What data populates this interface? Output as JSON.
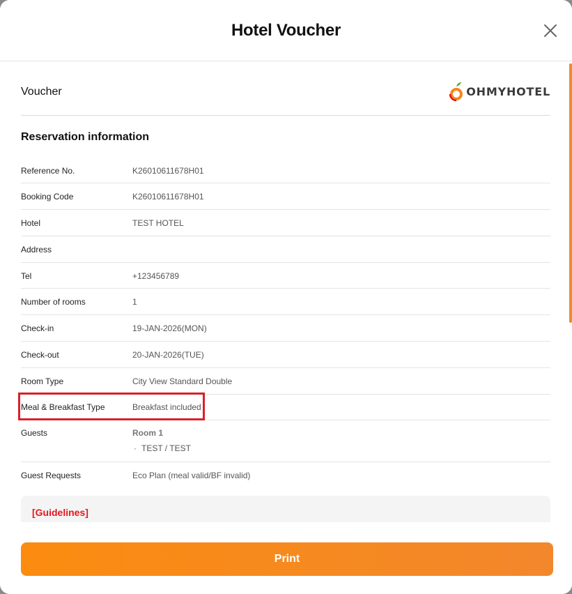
{
  "modal": {
    "title": "Hotel Voucher"
  },
  "voucher": {
    "label": "Voucher",
    "logo_text": "OHMYHOTEL"
  },
  "reservation": {
    "section_title": "Reservation information",
    "rows": [
      {
        "label": "Reference No.",
        "value": "K26010611678H01"
      },
      {
        "label": "Booking Code",
        "value": "K26010611678H01"
      },
      {
        "label": "Hotel",
        "value": "TEST HOTEL"
      },
      {
        "label": "Address",
        "value": ""
      },
      {
        "label": "Tel",
        "value": "+123456789"
      },
      {
        "label": "Number of rooms",
        "value": "1"
      },
      {
        "label": "Check-in",
        "value": "19-JAN-2026(MON)"
      },
      {
        "label": "Check-out",
        "value": "20-JAN-2026(TUE)"
      },
      {
        "label": "Room Type",
        "value": "City View Standard Double"
      },
      {
        "label": "Meal & Breakfast Type",
        "value": "Breakfast included"
      }
    ],
    "guests": {
      "label": "Guests",
      "room_label": "Room 1",
      "guest_entry": "TEST / TEST",
      "bullet": "·"
    },
    "guest_requests": {
      "label": "Guest Requests",
      "value": "Eco Plan (meal valid/BF invalid)"
    }
  },
  "guidelines": {
    "title": "[Guidelines]"
  },
  "footer": {
    "print_label": "Print"
  },
  "colors": {
    "accent": "#f5871c",
    "highlight": "#d9202a",
    "guidelines_red": "#e8141c"
  }
}
